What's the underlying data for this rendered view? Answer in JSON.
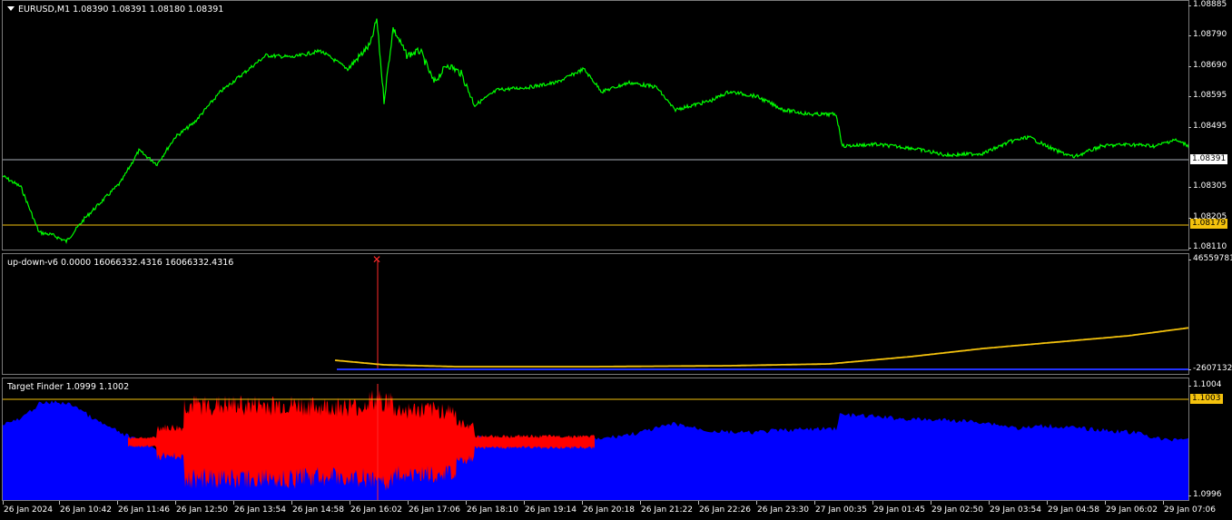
{
  "main": {
    "symbol_label": "EURUSD,M1  1.08390 1.08391 1.08180 1.08391",
    "y_labels": [
      "1.08885",
      "1.08790",
      "1.08690",
      "1.08595",
      "1.08495",
      "1.08305",
      "1.08205",
      "1.08110"
    ],
    "current_price": "1.08391",
    "level_price": "1.08179",
    "line_color": "#00ff00",
    "level_color": "#f4c20d"
  },
  "indicator": {
    "label": "up-down-v6 0.0000 16066332.4316  16066332.4316",
    "y_top": "46559781.",
    "y_bottom": "-2607132.",
    "signal_marker": "✕",
    "line_color": "#f4c20d",
    "baseline_color": "#2233ff"
  },
  "target_finder": {
    "label": "Target Finder 1.0999 1.1002",
    "y_top": "1.1004",
    "level_price": "1.1003",
    "y_bottom": "1.0996",
    "fill_blue": "#0000ff",
    "fill_red": "#ff0000"
  },
  "time_axis": [
    "26 Jan 2024",
    "26 Jan 10:42",
    "26 Jan 11:46",
    "26 Jan 12:50",
    "26 Jan 13:54",
    "26 Jan 14:58",
    "26 Jan 16:02",
    "26 Jan 17:06",
    "26 Jan 18:10",
    "26 Jan 19:14",
    "26 Jan 20:18",
    "26 Jan 21:22",
    "26 Jan 22:26",
    "26 Jan 23:30",
    "27 Jan 00:35",
    "29 Jan 01:45",
    "29 Jan 02:50",
    "29 Jan 03:54",
    "29 Jan 04:58",
    "29 Jan 06:02",
    "29 Jan 07:06"
  ]
}
